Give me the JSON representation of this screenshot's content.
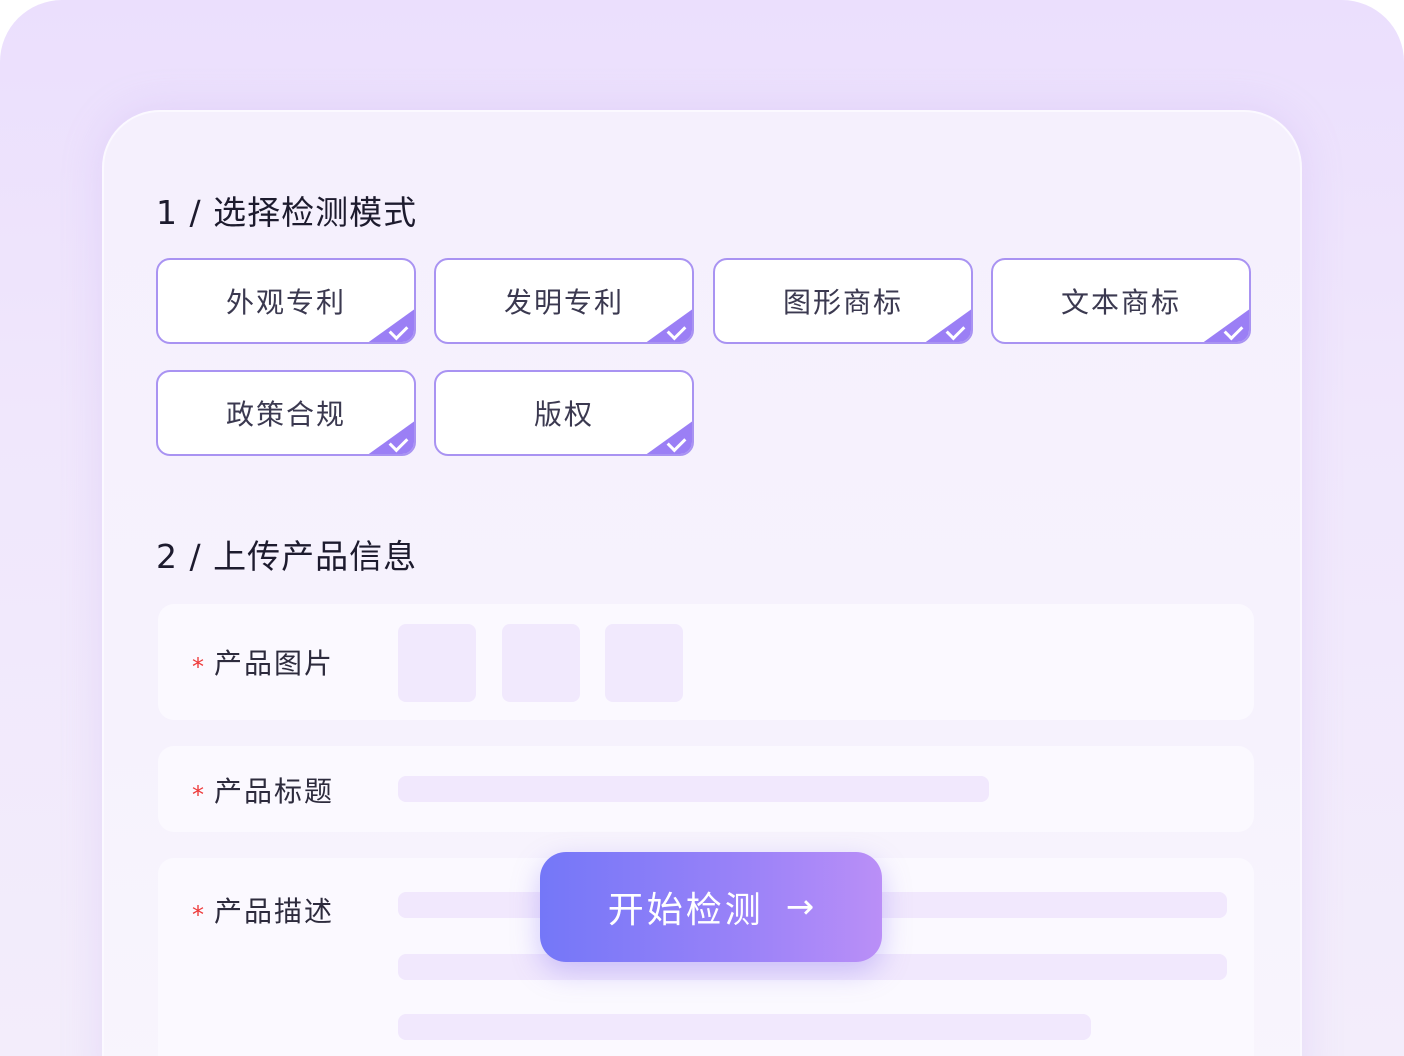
{
  "section1": {
    "title": "1 / 选择检测模式",
    "options": [
      {
        "label": "外观专利",
        "selected": true
      },
      {
        "label": "发明专利",
        "selected": true
      },
      {
        "label": "图形商标",
        "selected": true
      },
      {
        "label": "文本商标",
        "selected": true
      },
      {
        "label": "政策合规",
        "selected": true
      },
      {
        "label": "版权",
        "selected": true
      }
    ]
  },
  "section2": {
    "title": "2 / 上传产品信息",
    "required_mark": "*",
    "fields": {
      "image_label": "产品图片",
      "title_label": "产品标题",
      "desc_label": "产品描述"
    }
  },
  "start_button": {
    "label": "开始检测",
    "icon": "arrow-right-icon"
  },
  "colors": {
    "accent": "#9b7ff5",
    "required": "#ee3a3a",
    "button_start": "#7477f8",
    "button_end": "#ba8ff7"
  }
}
